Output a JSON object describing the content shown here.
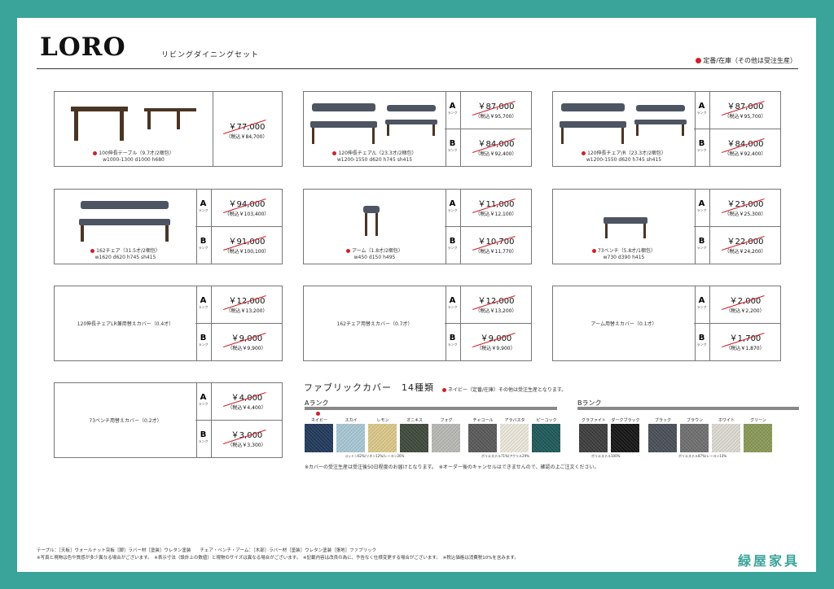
{
  "header": {
    "logo": "LORO",
    "subtitle": "リビングダイニングセット",
    "stock_note": "定番/在庫（その他は受注生産）"
  },
  "products": [
    {
      "name": "100伸長テーブル（9.7才/2梱包）",
      "size": "w1000-1300 d1000 h680",
      "stock": true,
      "prices": [
        {
          "rank": "",
          "price": "￥77,000",
          "tax": "（税込￥84,700）"
        }
      ]
    },
    {
      "name": "120伸長チェア/L（23.3才/2梱包）",
      "size": "w1200-1550 d620 h745 sh415",
      "stock": true,
      "prices": [
        {
          "rank": "A",
          "price": "￥87,000",
          "tax": "（税込￥95,700）"
        },
        {
          "rank": "B",
          "price": "￥84,000",
          "tax": "（税込￥92,400）"
        }
      ]
    },
    {
      "name": "120伸長チェア/R（23.3才/2梱包）",
      "size": "w1200-1550 d620 h745 sh415",
      "stock": true,
      "prices": [
        {
          "rank": "A",
          "price": "￥87,000",
          "tax": "（税込￥95,700）"
        },
        {
          "rank": "B",
          "price": "￥84,000",
          "tax": "（税込￥92,400）"
        }
      ]
    },
    {
      "name": "162チェア（31.5才/2梱包）",
      "size": "w1620 d620 h745 sh415",
      "stock": true,
      "prices": [
        {
          "rank": "A",
          "price": "￥94,000",
          "tax": "（税込￥103,400）"
        },
        {
          "rank": "B",
          "price": "￥91,000",
          "tax": "（税込￥100,100）"
        }
      ]
    },
    {
      "name": "アーム（1.8才/2梱包）",
      "size": "w450 d150 h495",
      "stock": true,
      "prices": [
        {
          "rank": "A",
          "price": "￥11,000",
          "tax": "（税込￥12,100）"
        },
        {
          "rank": "B",
          "price": "￥10,700",
          "tax": "（税込￥11,770）"
        }
      ]
    },
    {
      "name": "73ベンチ（5.8才/1梱包）",
      "size": "w730 d390 h415",
      "stock": true,
      "prices": [
        {
          "rank": "A",
          "price": "￥23,000",
          "tax": "（税込￥25,300）"
        },
        {
          "rank": "B",
          "price": "￥22,000",
          "tax": "（税込￥24,200）"
        }
      ]
    },
    {
      "name": "120伸長チェアLR兼用替えカバー（0.4才）",
      "prices": [
        {
          "rank": "A",
          "price": "￥12,000",
          "tax": "（税込￥13,200）"
        },
        {
          "rank": "B",
          "price": "￥9,000",
          "tax": "（税込￥9,900）"
        }
      ]
    },
    {
      "name": "162チェア用替えカバー（0.7才）",
      "prices": [
        {
          "rank": "A",
          "price": "￥12,000",
          "tax": "（税込￥13,200）"
        },
        {
          "rank": "B",
          "price": "￥9,000",
          "tax": "（税込￥9,900）"
        }
      ]
    },
    {
      "name": "アーム用替えカバー（0.1才）",
      "prices": [
        {
          "rank": "A",
          "price": "￥2,000",
          "tax": "（税込￥2,200）"
        },
        {
          "rank": "B",
          "price": "￥1,700",
          "tax": "（税込￥1,870）"
        }
      ]
    },
    {
      "name": "73ベンチ用替えカバー（0.2才）",
      "prices": [
        {
          "rank": "A",
          "price": "￥4,000",
          "tax": "（税込￥4,400）"
        },
        {
          "rank": "B",
          "price": "￥3,000",
          "tax": "（税込￥3,300）"
        }
      ]
    }
  ],
  "rank_sub": "ランク",
  "fabric": {
    "title": "ファブリックカバー　14種類",
    "note": "ネイビー（定番/在庫）その他は受注生産となります。",
    "rankA": "Aランク",
    "rankB": "Bランク",
    "swatches": [
      {
        "name": "ネイビー",
        "color": "#223a5c"
      },
      {
        "name": "スカイ",
        "color": "#a9c8d6"
      },
      {
        "name": "レモン",
        "color": "#dcc98a"
      },
      {
        "name": "オニキス",
        "color": "#3f4a3c"
      },
      {
        "name": "フォグ",
        "color": "#b9b9b6"
      },
      {
        "name": "チャコール",
        "color": "#5a5a5a"
      },
      {
        "name": "アラバスタ",
        "color": "#ece8dc"
      },
      {
        "name": "ピーコック",
        "color": "#1f5a5a"
      },
      {
        "name": "グラファイト",
        "color": "#3e3e3e"
      },
      {
        "name": "ダークブラック",
        "color": "#161616"
      },
      {
        "name": "ブラック",
        "color": "#4a5058"
      },
      {
        "name": "ブラウン",
        "color": "#707070"
      },
      {
        "name": "ホワイト",
        "color": "#dedbd3"
      },
      {
        "name": "グリーン",
        "color": "#8a9a58"
      }
    ],
    "comp1": "コットン62%/リネン12%/レーヨン26%",
    "comp2": "ポリエステル71%/アクリル29%",
    "comp3": "ポリエステル100%",
    "comp4": "ポリエステル87%/レーヨン13%",
    "order_note": "※カバーの受注生産は受注後50日程度のお届けとなります。　※オーダー後のキャンセルはできませんので、確認の上ご注文ください。"
  },
  "footer": {
    "line1": "テーブル：［天板］ウォールナット突板［脚］ラバー材［塗装］ウレタン塗装　　チェア・ベンチ・アーム：［木部］ラバー材［塗装］ウレタン塗装［張地］ファブリック",
    "line2": "※写真と現物は色や質感が多少異なる場合がございます。　※表示寸法（設計上の数値）と現物のサイズは異なる場合がございます。　※記載内容は改良の為に、予告なく仕様変更する場合がございます。　※税込価格は消費税10%を含みます。",
    "brand": "緑屋家具"
  }
}
